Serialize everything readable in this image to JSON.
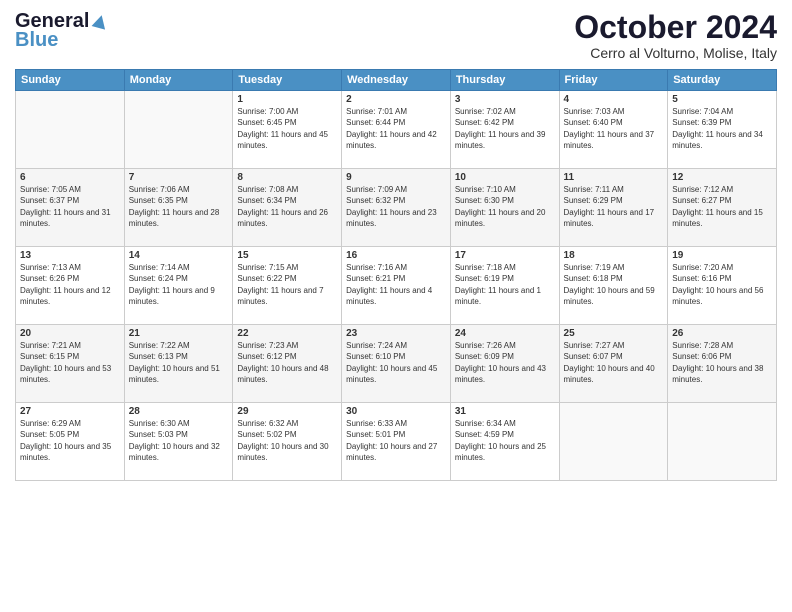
{
  "header": {
    "logo_general": "General",
    "logo_blue": "Blue",
    "month_title": "October 2024",
    "location": "Cerro al Volturno, Molise, Italy"
  },
  "weekdays": [
    "Sunday",
    "Monday",
    "Tuesday",
    "Wednesday",
    "Thursday",
    "Friday",
    "Saturday"
  ],
  "weeks": [
    [
      {
        "day": "",
        "sunrise": "",
        "sunset": "",
        "daylight": ""
      },
      {
        "day": "",
        "sunrise": "",
        "sunset": "",
        "daylight": ""
      },
      {
        "day": "1",
        "sunrise": "Sunrise: 7:00 AM",
        "sunset": "Sunset: 6:45 PM",
        "daylight": "Daylight: 11 hours and 45 minutes."
      },
      {
        "day": "2",
        "sunrise": "Sunrise: 7:01 AM",
        "sunset": "Sunset: 6:44 PM",
        "daylight": "Daylight: 11 hours and 42 minutes."
      },
      {
        "day": "3",
        "sunrise": "Sunrise: 7:02 AM",
        "sunset": "Sunset: 6:42 PM",
        "daylight": "Daylight: 11 hours and 39 minutes."
      },
      {
        "day": "4",
        "sunrise": "Sunrise: 7:03 AM",
        "sunset": "Sunset: 6:40 PM",
        "daylight": "Daylight: 11 hours and 37 minutes."
      },
      {
        "day": "5",
        "sunrise": "Sunrise: 7:04 AM",
        "sunset": "Sunset: 6:39 PM",
        "daylight": "Daylight: 11 hours and 34 minutes."
      }
    ],
    [
      {
        "day": "6",
        "sunrise": "Sunrise: 7:05 AM",
        "sunset": "Sunset: 6:37 PM",
        "daylight": "Daylight: 11 hours and 31 minutes."
      },
      {
        "day": "7",
        "sunrise": "Sunrise: 7:06 AM",
        "sunset": "Sunset: 6:35 PM",
        "daylight": "Daylight: 11 hours and 28 minutes."
      },
      {
        "day": "8",
        "sunrise": "Sunrise: 7:08 AM",
        "sunset": "Sunset: 6:34 PM",
        "daylight": "Daylight: 11 hours and 26 minutes."
      },
      {
        "day": "9",
        "sunrise": "Sunrise: 7:09 AM",
        "sunset": "Sunset: 6:32 PM",
        "daylight": "Daylight: 11 hours and 23 minutes."
      },
      {
        "day": "10",
        "sunrise": "Sunrise: 7:10 AM",
        "sunset": "Sunset: 6:30 PM",
        "daylight": "Daylight: 11 hours and 20 minutes."
      },
      {
        "day": "11",
        "sunrise": "Sunrise: 7:11 AM",
        "sunset": "Sunset: 6:29 PM",
        "daylight": "Daylight: 11 hours and 17 minutes."
      },
      {
        "day": "12",
        "sunrise": "Sunrise: 7:12 AM",
        "sunset": "Sunset: 6:27 PM",
        "daylight": "Daylight: 11 hours and 15 minutes."
      }
    ],
    [
      {
        "day": "13",
        "sunrise": "Sunrise: 7:13 AM",
        "sunset": "Sunset: 6:26 PM",
        "daylight": "Daylight: 11 hours and 12 minutes."
      },
      {
        "day": "14",
        "sunrise": "Sunrise: 7:14 AM",
        "sunset": "Sunset: 6:24 PM",
        "daylight": "Daylight: 11 hours and 9 minutes."
      },
      {
        "day": "15",
        "sunrise": "Sunrise: 7:15 AM",
        "sunset": "Sunset: 6:22 PM",
        "daylight": "Daylight: 11 hours and 7 minutes."
      },
      {
        "day": "16",
        "sunrise": "Sunrise: 7:16 AM",
        "sunset": "Sunset: 6:21 PM",
        "daylight": "Daylight: 11 hours and 4 minutes."
      },
      {
        "day": "17",
        "sunrise": "Sunrise: 7:18 AM",
        "sunset": "Sunset: 6:19 PM",
        "daylight": "Daylight: 11 hours and 1 minute."
      },
      {
        "day": "18",
        "sunrise": "Sunrise: 7:19 AM",
        "sunset": "Sunset: 6:18 PM",
        "daylight": "Daylight: 10 hours and 59 minutes."
      },
      {
        "day": "19",
        "sunrise": "Sunrise: 7:20 AM",
        "sunset": "Sunset: 6:16 PM",
        "daylight": "Daylight: 10 hours and 56 minutes."
      }
    ],
    [
      {
        "day": "20",
        "sunrise": "Sunrise: 7:21 AM",
        "sunset": "Sunset: 6:15 PM",
        "daylight": "Daylight: 10 hours and 53 minutes."
      },
      {
        "day": "21",
        "sunrise": "Sunrise: 7:22 AM",
        "sunset": "Sunset: 6:13 PM",
        "daylight": "Daylight: 10 hours and 51 minutes."
      },
      {
        "day": "22",
        "sunrise": "Sunrise: 7:23 AM",
        "sunset": "Sunset: 6:12 PM",
        "daylight": "Daylight: 10 hours and 48 minutes."
      },
      {
        "day": "23",
        "sunrise": "Sunrise: 7:24 AM",
        "sunset": "Sunset: 6:10 PM",
        "daylight": "Daylight: 10 hours and 45 minutes."
      },
      {
        "day": "24",
        "sunrise": "Sunrise: 7:26 AM",
        "sunset": "Sunset: 6:09 PM",
        "daylight": "Daylight: 10 hours and 43 minutes."
      },
      {
        "day": "25",
        "sunrise": "Sunrise: 7:27 AM",
        "sunset": "Sunset: 6:07 PM",
        "daylight": "Daylight: 10 hours and 40 minutes."
      },
      {
        "day": "26",
        "sunrise": "Sunrise: 7:28 AM",
        "sunset": "Sunset: 6:06 PM",
        "daylight": "Daylight: 10 hours and 38 minutes."
      }
    ],
    [
      {
        "day": "27",
        "sunrise": "Sunrise: 6:29 AM",
        "sunset": "Sunset: 5:05 PM",
        "daylight": "Daylight: 10 hours and 35 minutes."
      },
      {
        "day": "28",
        "sunrise": "Sunrise: 6:30 AM",
        "sunset": "Sunset: 5:03 PM",
        "daylight": "Daylight: 10 hours and 32 minutes."
      },
      {
        "day": "29",
        "sunrise": "Sunrise: 6:32 AM",
        "sunset": "Sunset: 5:02 PM",
        "daylight": "Daylight: 10 hours and 30 minutes."
      },
      {
        "day": "30",
        "sunrise": "Sunrise: 6:33 AM",
        "sunset": "Sunset: 5:01 PM",
        "daylight": "Daylight: 10 hours and 27 minutes."
      },
      {
        "day": "31",
        "sunrise": "Sunrise: 6:34 AM",
        "sunset": "Sunset: 4:59 PM",
        "daylight": "Daylight: 10 hours and 25 minutes."
      },
      {
        "day": "",
        "sunrise": "",
        "sunset": "",
        "daylight": ""
      },
      {
        "day": "",
        "sunrise": "",
        "sunset": "",
        "daylight": ""
      }
    ]
  ]
}
